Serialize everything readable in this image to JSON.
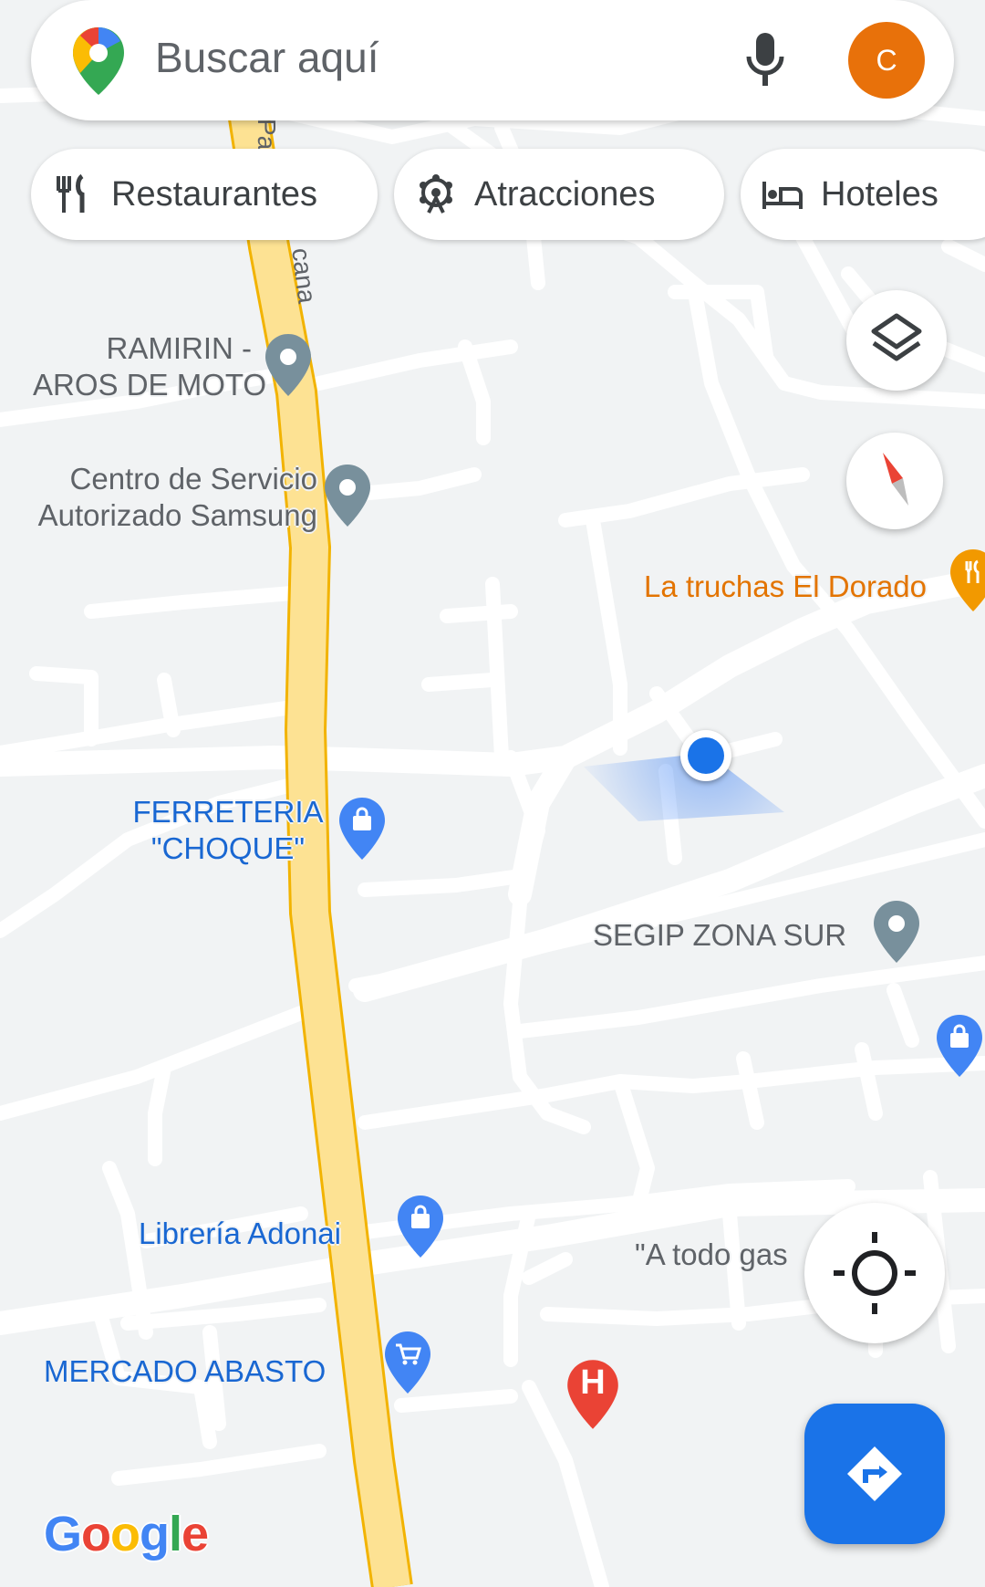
{
  "search": {
    "placeholder": "Buscar aquí",
    "avatar_letter": "C"
  },
  "chips": [
    {
      "label": "Restaurantes",
      "icon": "restaurant-icon"
    },
    {
      "label": "Atracciones",
      "icon": "attractions-icon"
    },
    {
      "label": "Hoteles",
      "icon": "hotel-icon"
    }
  ],
  "road_labels": {
    "street_a": "Pa",
    "street_b": "cana"
  },
  "pois": [
    {
      "name_line1": "RAMIRIN -",
      "name_line2": "AROS DE MOTO"
    },
    {
      "name_line1": "Centro de Servicio",
      "name_line2": "Autorizado Samsung"
    },
    {
      "name": "La truchas El Dorado"
    },
    {
      "name_line1": "FERRETERIA",
      "name_line2": "\"CHOQUE\""
    },
    {
      "name": "SEGIP ZONA SUR"
    },
    {
      "name": "Librería Adonai"
    },
    {
      "name": "\"A todo gas"
    },
    {
      "name": "MERCADO ABASTO"
    }
  ],
  "hospital_marker": "H",
  "brand": {
    "logo_letters": [
      "G",
      "o",
      "o",
      "g",
      "l",
      "e"
    ]
  },
  "colors": {
    "accent": "#1a73e8",
    "avatar": "#e8710a",
    "main_road": "#fde293",
    "map_bg": "#f1f3f4"
  }
}
